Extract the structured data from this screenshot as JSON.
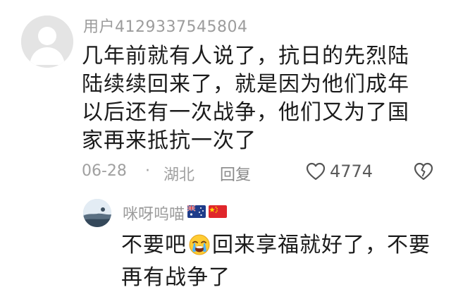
{
  "comment": {
    "username": "用户4129337545804",
    "text": "几年前就有人说了，抗日的先烈陆陆续续回来了，就是因为他们成年以后还有一次战争，他们又为了国家再来抵抗一次了",
    "date": "06-28",
    "separator": "·",
    "location": "湖北",
    "reply_label": "回复",
    "like_count": "4774",
    "icons": {
      "like": "heart-icon",
      "dislike": "broken-heart-icon"
    }
  },
  "reply": {
    "username": "咪呀呜喵",
    "flags": [
      "australia-flag-icon",
      "china-flag-icon"
    ],
    "text_before": "不要吧",
    "emoji": "crying-face-emoji-icon",
    "text_after": "回来享福就好了，不要再有战争了"
  }
}
